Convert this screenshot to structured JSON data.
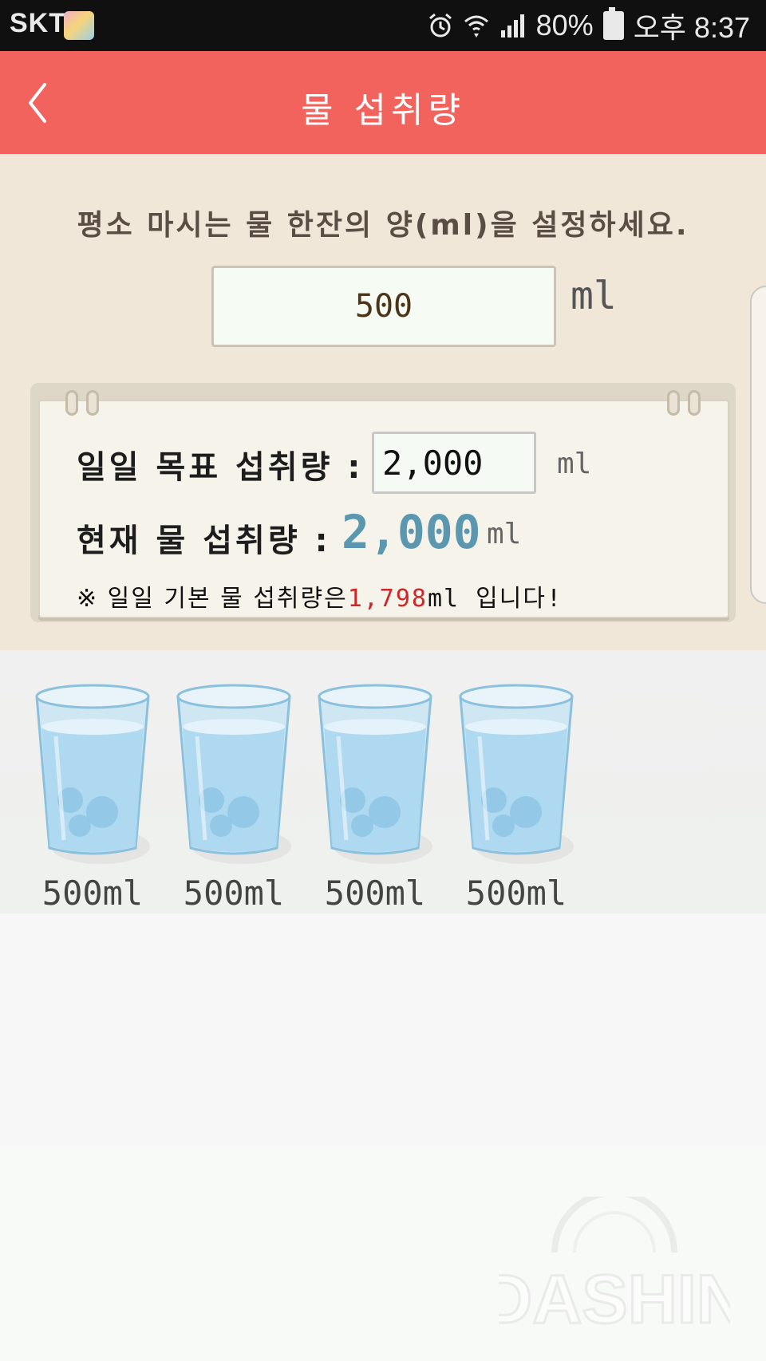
{
  "status_bar": {
    "carrier": "SKT",
    "battery": "80%",
    "time": "오후 8:37",
    "icons": [
      "alarm-icon",
      "wifi-icon",
      "signal-icon",
      "battery-charging-icon"
    ]
  },
  "header": {
    "title": "물 섭취량",
    "back_icon": "chevron-left-icon",
    "bg_color": "#f2635e"
  },
  "glass_setting": {
    "instruction": "평소 마시는 물 한잔의 양(ml)을 설정하세요.",
    "value": "500",
    "unit": "ml"
  },
  "goal_card": {
    "goal_label": "일일 목표 섭취량 :",
    "goal_value": "2,000",
    "goal_unit": "ml",
    "current_label": "현재 물 섭취량 :",
    "current_value": "2,000",
    "current_unit": "ml",
    "note_prefix": "※ 일일 기본 물 섭취량은",
    "note_value": "1,798",
    "note_suffix": "ml 입니다!",
    "accent_color": "#5b98b0",
    "note_color": "#d0262a"
  },
  "glasses": [
    {
      "label": "500ml"
    },
    {
      "label": "500ml"
    },
    {
      "label": "500ml"
    },
    {
      "label": "500ml"
    }
  ],
  "watermark": {
    "text": "DASHIN"
  }
}
